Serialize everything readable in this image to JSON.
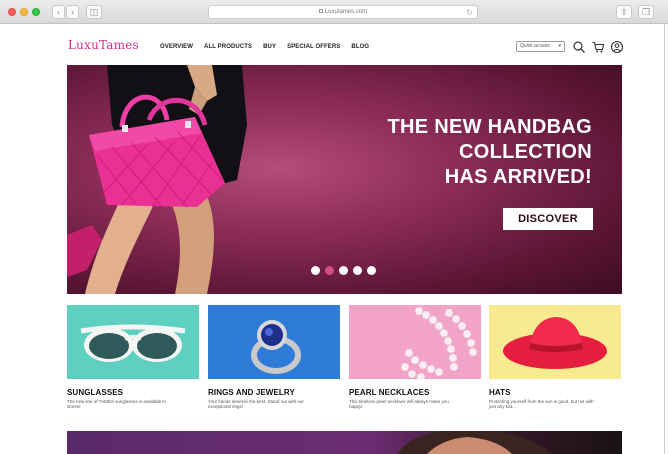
{
  "browser": {
    "url": "Luxutames.com",
    "back_icon": "chevron-left-icon",
    "forward_icon": "chevron-right-icon",
    "sidebar_icon": "sidebar-icon"
  },
  "site": {
    "logo": "LuxuTames",
    "brand_color": "#d0308a",
    "nav": [
      {
        "label": "OVERVIEW"
      },
      {
        "label": "ALL PRODUCTS"
      },
      {
        "label": "BUY"
      },
      {
        "label": "SPECIAL OFFERS"
      },
      {
        "label": "BLOG"
      }
    ],
    "quick_access": "Quick access",
    "icons": [
      "search-icon",
      "cart-icon",
      "account-icon"
    ]
  },
  "hero": {
    "headline_line1": "THE NEW HANDBAG",
    "headline_line2": "COLLECTION",
    "headline_line3": "HAS ARRIVED!",
    "cta": "DISCOVER",
    "slides_total": 5,
    "active_slide": 2,
    "accent_color": "#8e2d59"
  },
  "categories": [
    {
      "title": "SUNGLASSES",
      "desc": "The new line of TAMES sunglasses is available in stores!"
    },
    {
      "title": "RINGS AND JEWELRY",
      "desc": "Your hands deserve the best. Stand out with our exceptional rings!"
    },
    {
      "title": "PEARL NECKLACES",
      "desc": "This timeless pearl necklace will always make you happy!"
    },
    {
      "title": "HATS",
      "desc": "Protecting yourself from the sun is good, but not with just any hat..."
    }
  ]
}
